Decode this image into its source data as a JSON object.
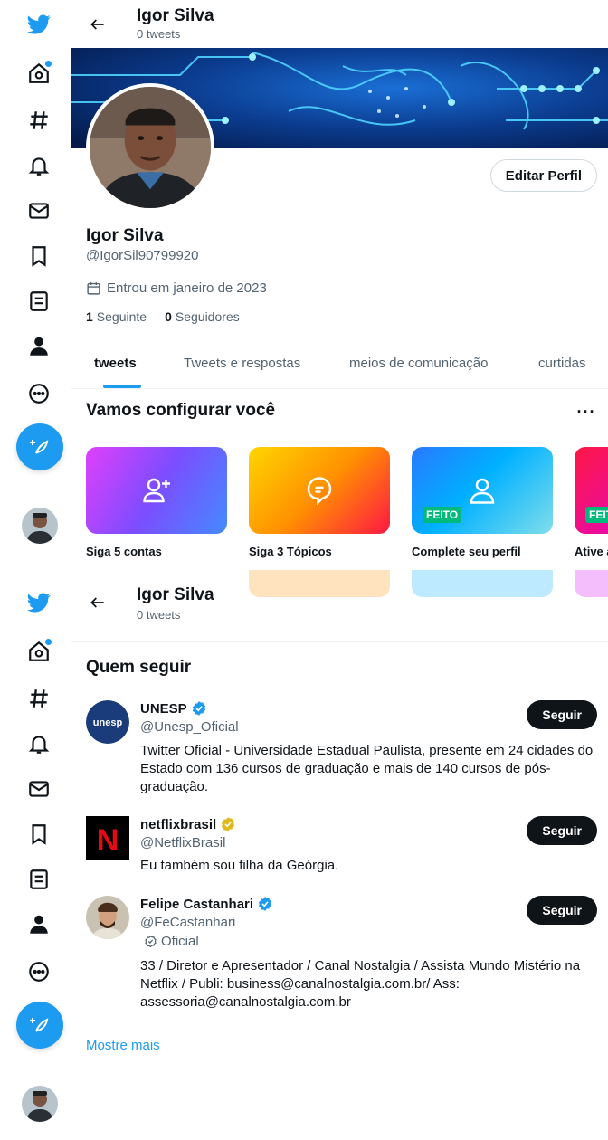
{
  "profile": {
    "name": "Igor Silva",
    "tweet_count": "0 tweets",
    "handle": "@IgorSil90799920",
    "joined": "Entrou em janeiro de 2023",
    "following_count": "1",
    "following_label": "Seguinte",
    "followers_count": "0",
    "followers_label": "Seguidores",
    "edit_button": "Editar Perfil"
  },
  "tabs": [
    {
      "label": "tweets",
      "active": true
    },
    {
      "label": "Tweets e respostas",
      "active": false
    },
    {
      "label": "meios de comunicação",
      "active": false
    },
    {
      "label": "curtidas",
      "active": false
    }
  ],
  "setup": {
    "title": "Vamos configurar você",
    "more": "···",
    "cards": [
      {
        "label": "Siga 5 contas",
        "icon": "add-user-icon",
        "done": false
      },
      {
        "label": "Siga 3 Tópicos",
        "icon": "topic-bubble-icon",
        "done": false
      },
      {
        "label": "Complete seu perfil",
        "icon": "user-icon",
        "done": true,
        "badge": "FEITO"
      },
      {
        "label": "Ative a",
        "icon": "bell-icon",
        "done": true,
        "badge": "FEITO"
      }
    ]
  },
  "who_to_follow": {
    "title": "Quem seguir",
    "button_label": "Seguir",
    "more_link": "Mostre mais",
    "accounts": [
      {
        "name": "UNESP",
        "handle": "@Unesp_Oficial",
        "verified": "blue",
        "avatar_text": "unesp",
        "bio": "Twitter Oficial - Universidade Estadual Paulista, presente em 24 cidades do Estado com 136 cursos de graduação e mais de 140 cursos de pós-graduação."
      },
      {
        "name": "netflixbrasil",
        "handle": "@NetflixBrasil",
        "verified": "gold",
        "avatar_text": "N",
        "bio": "Eu também sou filha da Geórgia."
      },
      {
        "name": "Felipe Castanhari",
        "handle": "@FeCastanhari",
        "verified": "blue",
        "official_label": "Oficial",
        "bio": "33 / Diretor e Apresentador / Canal Nostalgia / Assista Mundo Mistério na Netflix / Publi: business@canalnostalgia.com.br/ Ass: assessoria@canalnostalgia.com.br"
      }
    ]
  },
  "colors": {
    "accent": "#1d9bf0",
    "text": "#0f1419",
    "muted": "#536471",
    "done_badge": "#00ba7c"
  }
}
